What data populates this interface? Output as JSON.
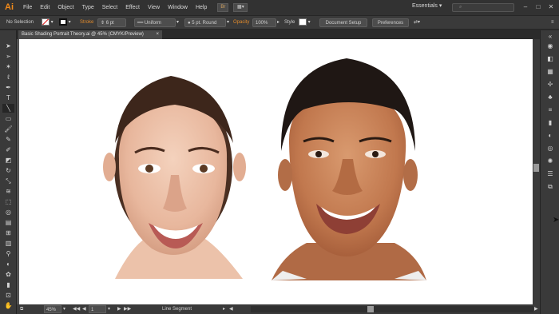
{
  "app": {
    "logo": "Ai",
    "accent": "#f28a1a"
  },
  "menu": {
    "items": [
      "File",
      "Edit",
      "Object",
      "Type",
      "Select",
      "Effect",
      "View",
      "Window",
      "Help"
    ],
    "bridge": "Br",
    "workspace": "Essentials"
  },
  "control": {
    "selection": "No Selection",
    "stroke_label": "Stroke",
    "stroke_value": "6 pt",
    "uniform": "Uniform",
    "brush": "5 pt. Round",
    "opacity_label": "Opacity",
    "opacity_value": "100%",
    "style_label": "Style",
    "document_setup": "Document Setup",
    "preferences": "Preferences"
  },
  "document": {
    "tab_title": "Basic Shading Portrait Theory.ai @ 45% (CMYK/Preview)",
    "close": "×"
  },
  "status": {
    "zoom": "45%",
    "artboard": "1",
    "tool_name": "Line Segment"
  },
  "icons": {
    "tools": [
      "selection-tool",
      "direct-selection-tool",
      "magic-wand-tool",
      "lasso-tool",
      "pen-tool",
      "type-tool",
      "line-segment-tool",
      "rectangle-tool",
      "paintbrush-tool",
      "pencil-tool",
      "blob-brush-tool",
      "eraser-tool",
      "rotate-tool",
      "scale-tool",
      "warp-tool",
      "free-transform-tool",
      "shape-builder-tool",
      "perspective-grid-tool",
      "mesh-tool",
      "gradient-tool",
      "eyedropper-tool",
      "blend-tool",
      "symbol-sprayer-tool",
      "column-graph-tool",
      "artboard-tool",
      "slice-tool",
      "hand-tool",
      "zoom-tool"
    ],
    "panels": [
      "color-panel",
      "color-guide-panel",
      "swatches-panel",
      "brushes-panel",
      "symbols-panel",
      "stroke-panel",
      "gradient-panel",
      "transparency-panel",
      "appearance-panel",
      "graphic-styles-panel",
      "layers-panel",
      "artboards-panel"
    ]
  }
}
